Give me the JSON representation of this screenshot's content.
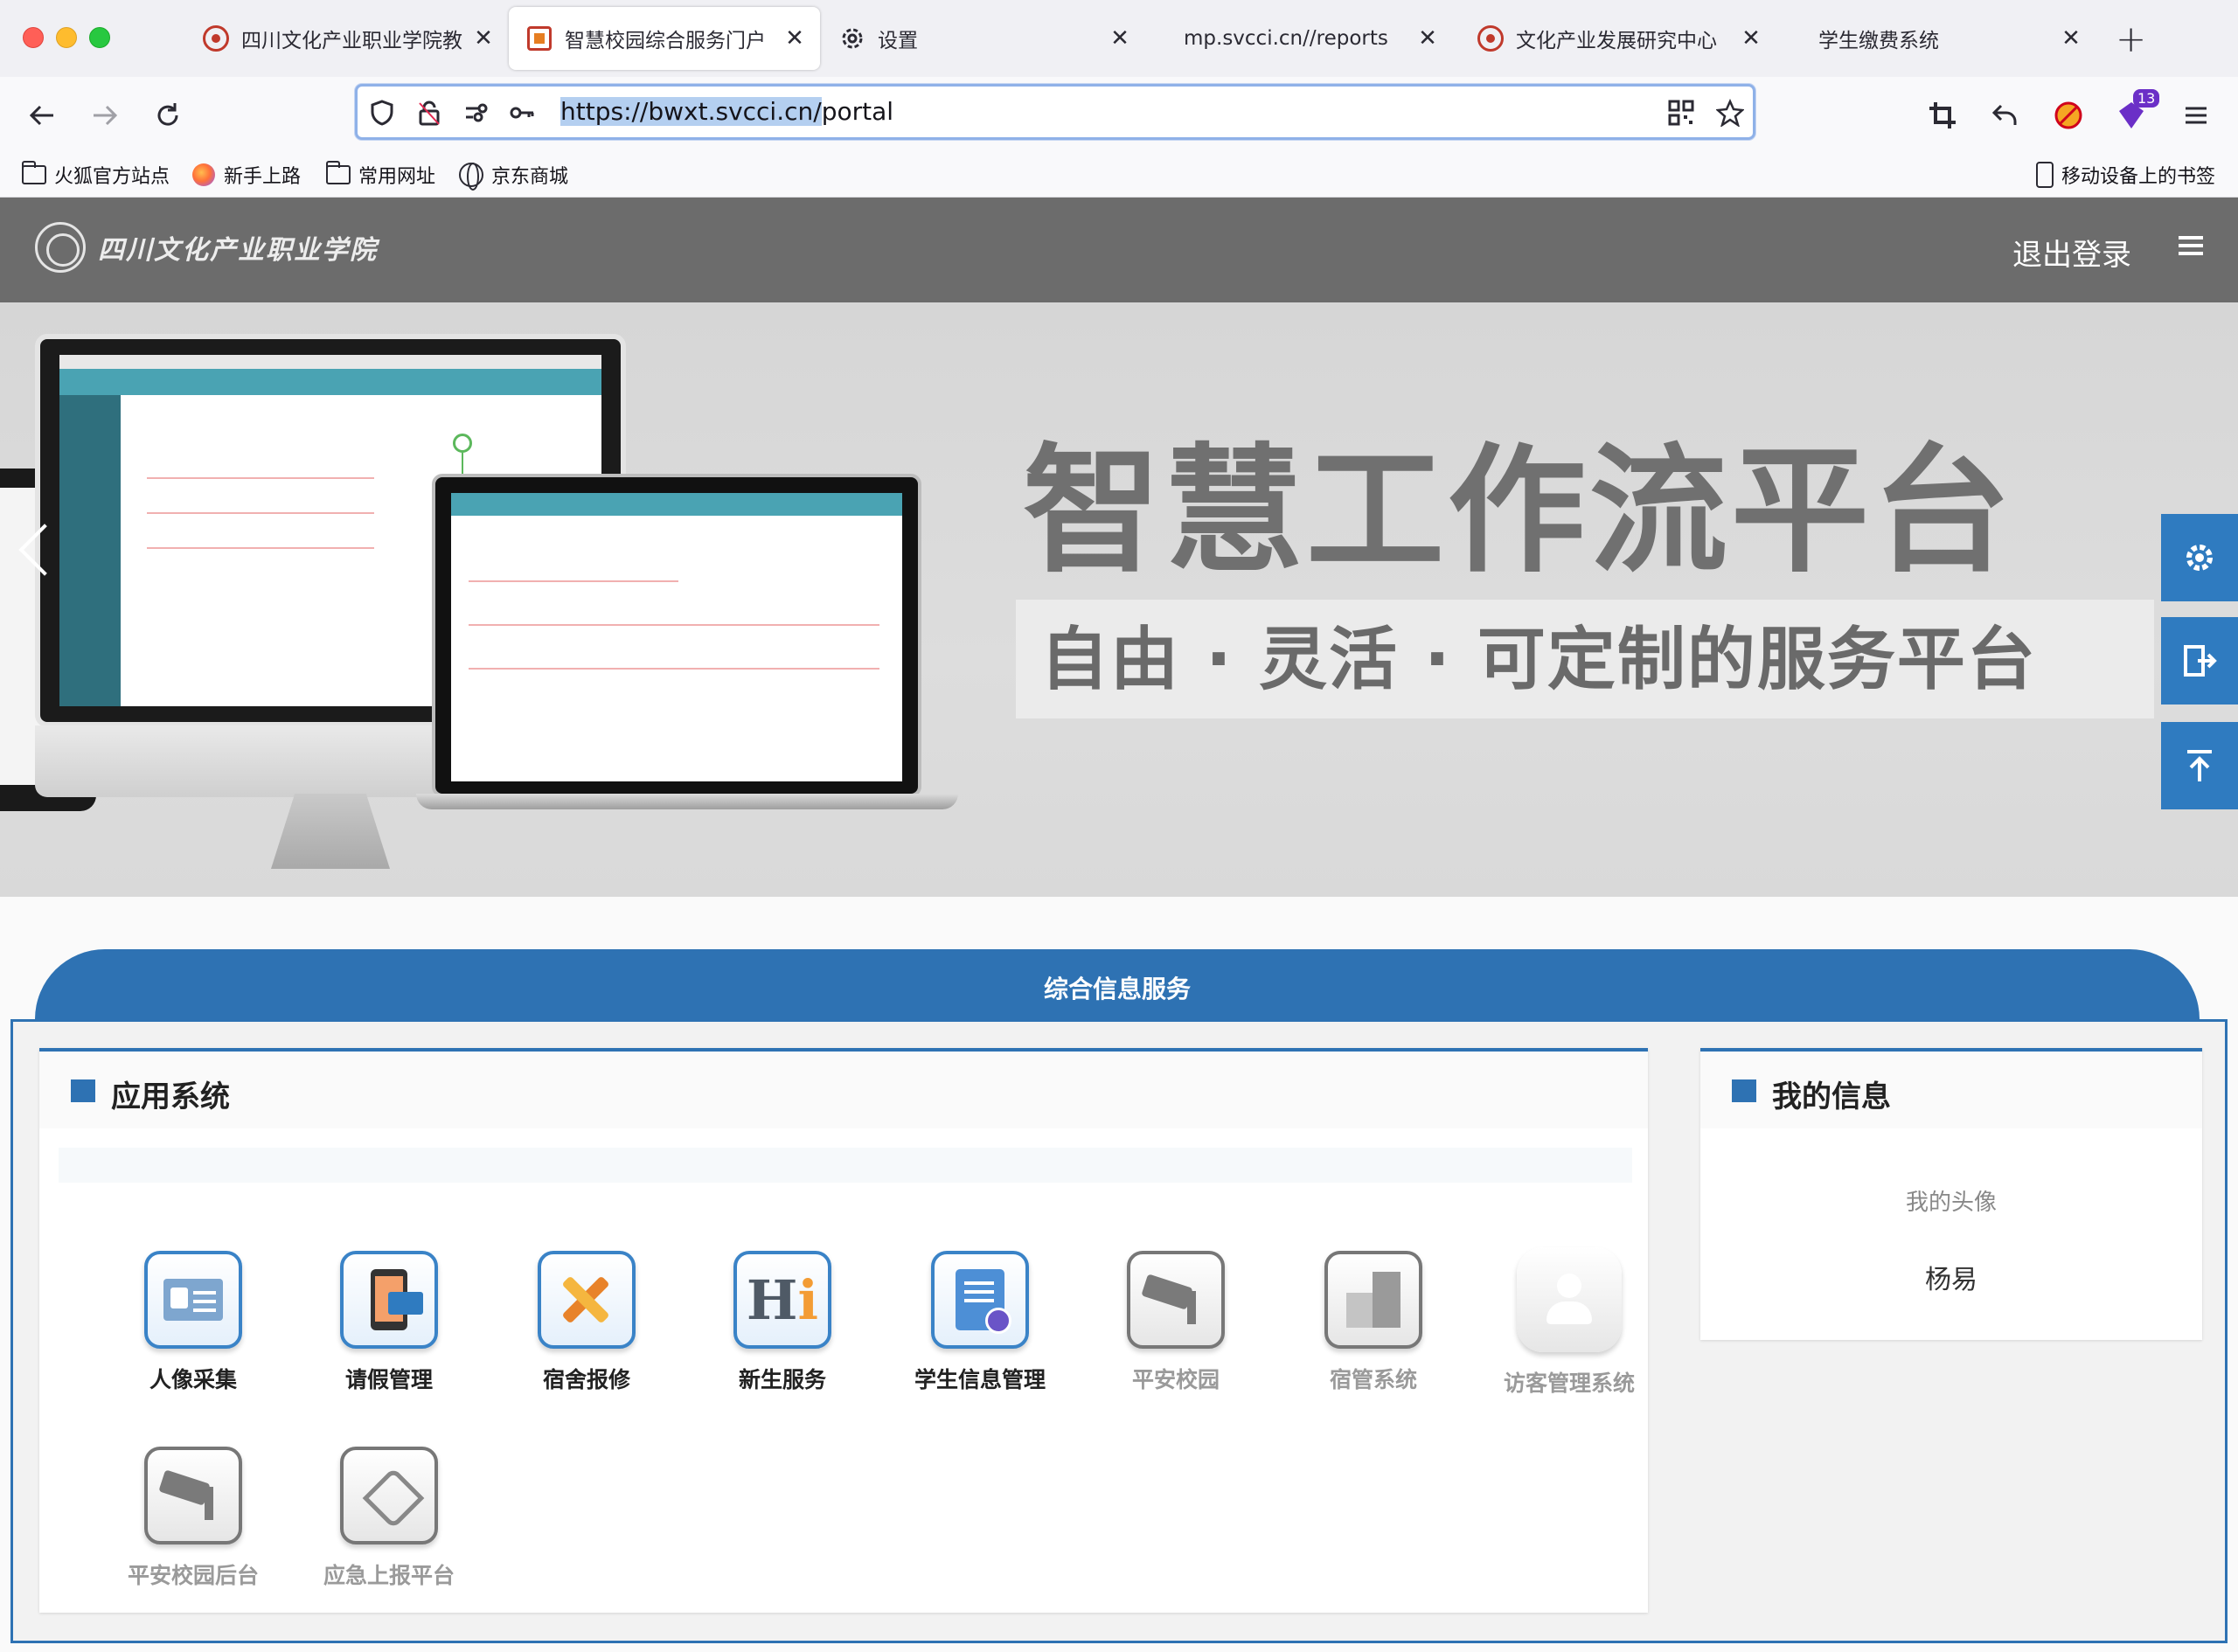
{
  "browser": {
    "tabs": [
      {
        "title": "四川文化产业职业学院教",
        "icon": "school-seal-icon",
        "active": false
      },
      {
        "title": "智慧校园综合服务门户",
        "icon": "portal-favicon-icon",
        "active": true
      },
      {
        "title": "设置",
        "icon": "gear-icon",
        "active": false
      },
      {
        "title": "mp.svcci.cn//reports",
        "icon": "",
        "active": false
      },
      {
        "title": "文化产业发展研究中心",
        "icon": "school-seal-icon",
        "active": false
      },
      {
        "title": "学生缴费系统",
        "icon": "",
        "active": false
      }
    ],
    "close_glyph": "✕",
    "new_tab_glyph": "+",
    "url_highlight": "https://bwxt.svcci.cn/",
    "url_rest": "portal",
    "extension_badge": "13",
    "bookmarks": [
      {
        "label": "火狐官方站点",
        "icon": "folder-icon"
      },
      {
        "label": "新手上路",
        "icon": "firefox-icon"
      },
      {
        "label": "常用网址",
        "icon": "folder-icon"
      },
      {
        "label": "京东商城",
        "icon": "globe-icon"
      }
    ],
    "mobile_bookmarks": "移动设备上的书签"
  },
  "site": {
    "logo_text": "四川文化产业职业学院",
    "logout": "退出登录",
    "banner_title": "智慧工作流平台",
    "banner_subtitle": "自由 · 灵活 · 可定制的服务平台",
    "section_title": "综合信息服务"
  },
  "apps_card": {
    "title": "应用系统",
    "apps": [
      {
        "label": "人像采集",
        "icon": "id-card-icon",
        "enabled": true
      },
      {
        "label": "请假管理",
        "icon": "mobile-leave-icon",
        "enabled": true
      },
      {
        "label": "宿舍报修",
        "icon": "repair-tools-icon",
        "enabled": true
      },
      {
        "label": "新生服务",
        "icon": "hi-icon",
        "enabled": true
      },
      {
        "label": "学生信息管理",
        "icon": "document-icon",
        "enabled": true
      },
      {
        "label": "平安校园",
        "icon": "security-camera-icon",
        "enabled": false
      },
      {
        "label": "宿管系统",
        "icon": "building-icon",
        "enabled": false
      },
      {
        "label": "访客管理系统",
        "icon": "visitor-icon",
        "enabled": false
      },
      {
        "label": "平安校园后台",
        "icon": "security-camera-icon",
        "enabled": false
      },
      {
        "label": "应急上报平台",
        "icon": "heart-hands-icon",
        "enabled": false
      }
    ]
  },
  "info_card": {
    "title": "我的信息",
    "avatar_label": "我的头像",
    "name": "杨易"
  }
}
